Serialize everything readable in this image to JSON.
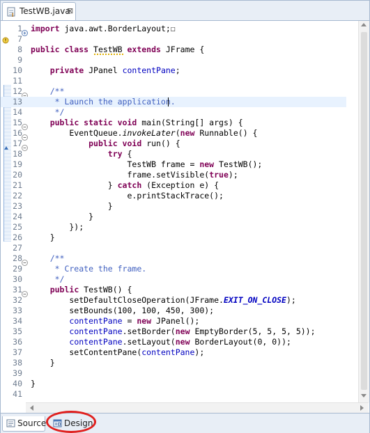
{
  "editor_tab": {
    "title": "TestWB.java",
    "close_label": "⊠"
  },
  "code_lines": [
    {
      "num": "1",
      "html": "<span class=\"kw\">import</span> java.awt.BorderLayout;☐"
    },
    {
      "num": "7",
      "html": ""
    },
    {
      "num": "8",
      "html": "<span class=\"kw\">public class</span> TestWB <span class=\"kw\">extends</span> JFrame {"
    },
    {
      "num": "9",
      "html": ""
    },
    {
      "num": "10",
      "html": "    <span class=\"kw\">private</span> JPanel <span class=\"fld\">contentPane</span>;"
    },
    {
      "num": "11",
      "html": ""
    },
    {
      "num": "12",
      "html": "    <span class=\"cm\">/**</span>"
    },
    {
      "num": "13",
      "html": "<span class=\"cm\">     * Launch the application.</span>"
    },
    {
      "num": "14",
      "html": "<span class=\"cm\">     */</span>"
    },
    {
      "num": "15",
      "html": "    <span class=\"kw\">public static void</span> main(String[] args) {"
    },
    {
      "num": "16",
      "html": "        EventQueue.<span class=\"sm\">invokeLater</span>(<span class=\"kw\">new</span> Runnable() {"
    },
    {
      "num": "17",
      "html": "            <span class=\"kw\">public void</span> run() {"
    },
    {
      "num": "18",
      "html": "                <span class=\"kw\">try</span> {"
    },
    {
      "num": "19",
      "html": "                    TestWB frame = <span class=\"kw\">new</span> TestWB();"
    },
    {
      "num": "20",
      "html": "                    frame.setVisible(<span class=\"kw\">true</span>);"
    },
    {
      "num": "21",
      "html": "                } <span class=\"kw\">catch</span> (Exception e) {"
    },
    {
      "num": "22",
      "html": "                    e.printStackTrace();"
    },
    {
      "num": "23",
      "html": "                }"
    },
    {
      "num": "24",
      "html": "            }"
    },
    {
      "num": "25",
      "html": "        });"
    },
    {
      "num": "26",
      "html": "    }"
    },
    {
      "num": "27",
      "html": ""
    },
    {
      "num": "28",
      "html": "    <span class=\"cm\">/**</span>"
    },
    {
      "num": "29",
      "html": "<span class=\"cm\">     * Create the frame.</span>"
    },
    {
      "num": "30",
      "html": "<span class=\"cm\">     */</span>"
    },
    {
      "num": "31",
      "html": "    <span class=\"kw\">public</span> TestWB() {"
    },
    {
      "num": "32",
      "html": "        setDefaultCloseOperation(JFrame.<span class=\"sfld\">EXIT_ON_CLOSE</span>);"
    },
    {
      "num": "33",
      "html": "        setBounds(100, 100, 450, 300);"
    },
    {
      "num": "34",
      "html": "        <span class=\"fld\">contentPane</span> = <span class=\"kw\">new</span> JPanel();"
    },
    {
      "num": "35",
      "html": "        <span class=\"fld\">contentPane</span>.setBorder(<span class=\"kw\">new</span> EmptyBorder(5, 5, 5, 5));"
    },
    {
      "num": "36",
      "html": "        <span class=\"fld\">contentPane</span>.setLayout(<span class=\"kw\">new</span> BorderLayout(0, 0));"
    },
    {
      "num": "37",
      "html": "        setContentPane(<span class=\"fld\">contentPane</span>);"
    },
    {
      "num": "38",
      "html": "    }"
    },
    {
      "num": "39",
      "html": ""
    },
    {
      "num": "40",
      "html": "}"
    },
    {
      "num": "41",
      "html": ""
    }
  ],
  "bottom_tabs": {
    "source_label": "Source",
    "design_label": "Design"
  },
  "colors": {
    "keyword": "#7f0055",
    "comment": "#3f5fbf",
    "field": "#0000c0",
    "highlight_ring": "#e0201e",
    "current_line": "#e8f2fe"
  }
}
